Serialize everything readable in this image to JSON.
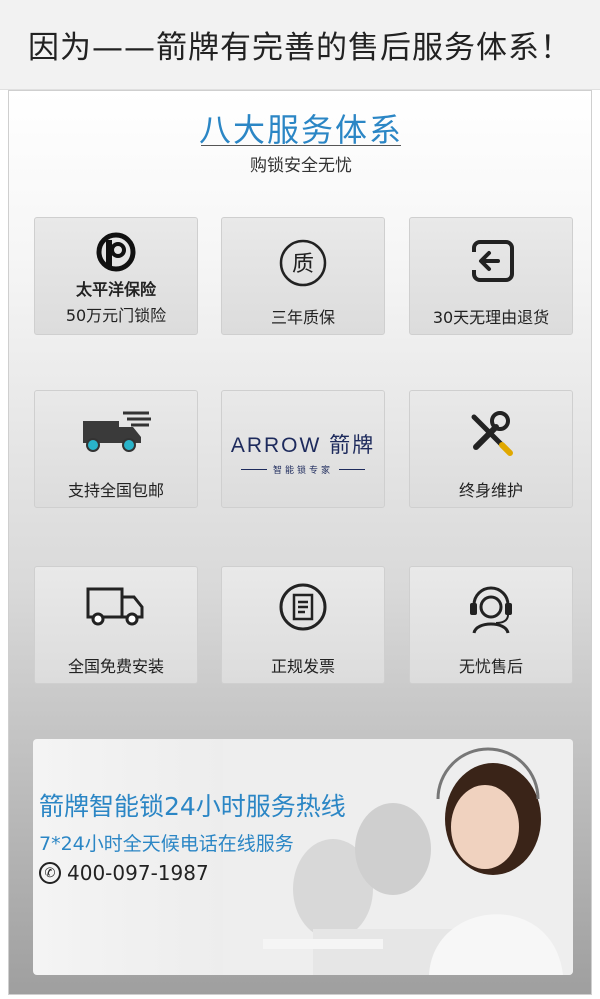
{
  "banner": {
    "headline": "因为——箭牌有完善的售后服务体系！"
  },
  "section": {
    "title": "八大服务体系",
    "subtitle": "购锁安全无忧"
  },
  "services": [
    {
      "icon": "pacific-insurance-logo-icon",
      "brand": "太平洋保险",
      "label": "50万元门锁险"
    },
    {
      "icon": "quality-seal-icon",
      "icon_char": "质",
      "label": "三年质保"
    },
    {
      "icon": "return-arrow-icon",
      "label": "30天无理由退货"
    },
    {
      "icon": "delivery-truck-icon",
      "label": "支持全国包邮"
    },
    {
      "icon": "arrow-brand-logo",
      "brand_word": "ARROW 箭牌",
      "brand_tag": "智能锁专家"
    },
    {
      "icon": "tools-icon",
      "label": "终身维护"
    },
    {
      "icon": "install-truck-icon",
      "label": "全国免费安装"
    },
    {
      "icon": "invoice-icon",
      "label": "正规发票"
    },
    {
      "icon": "headset-agent-icon",
      "label": "无忧售后"
    }
  ],
  "hotline": {
    "title": "箭牌智能锁24小时服务热线",
    "subtitle": "7*24小时全天候电话在线服务",
    "phone": "400-097-1987",
    "phone_icon": "phone-icon"
  },
  "colors": {
    "accent": "#2b86c5",
    "brand_navy": "#1d2a5c"
  }
}
